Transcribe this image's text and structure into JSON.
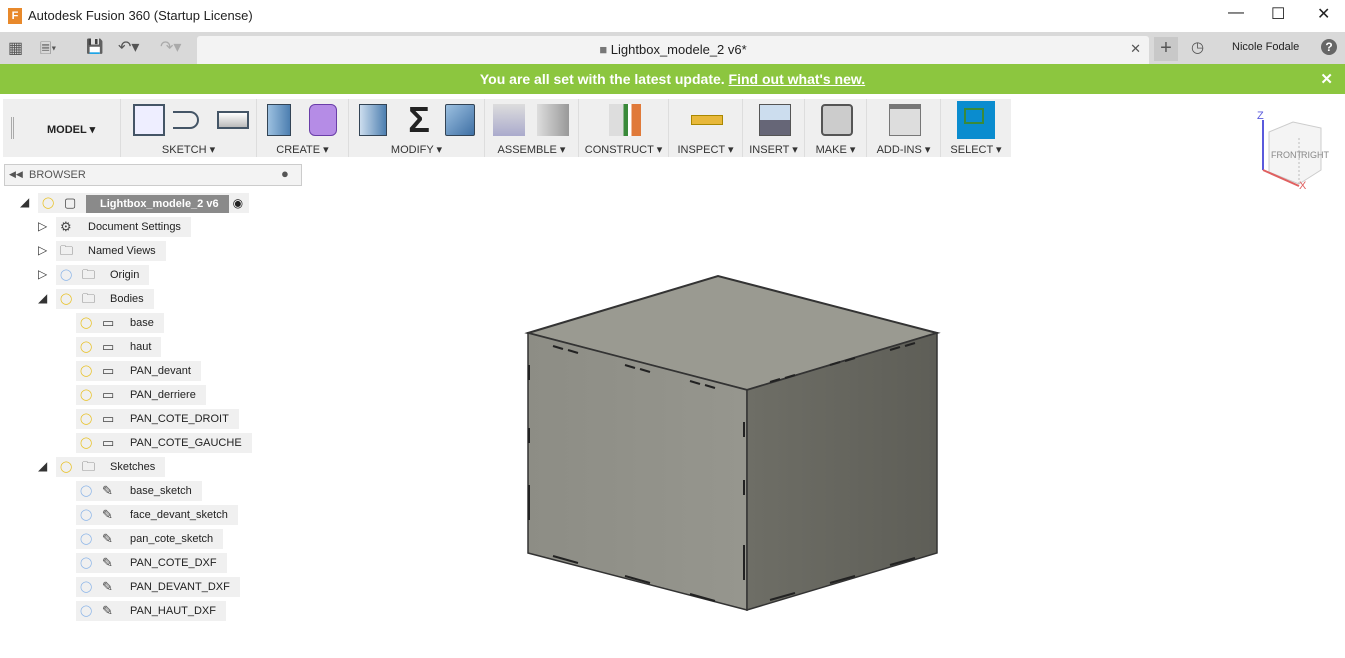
{
  "window": {
    "title": "Autodesk Fusion 360 (Startup License)",
    "app_icon": "F"
  },
  "tab": {
    "name": "Lightbox_modele_2 v6*",
    "user": "Nicole Fodale"
  },
  "banner": {
    "text": "You are all set with the latest update.",
    "link": "Find out what's new.",
    "color": "#8cc63f"
  },
  "toolbar": {
    "workspace": "MODEL ▾",
    "groups": [
      "SKETCH ▾",
      "CREATE ▾",
      "MODIFY ▾",
      "ASSEMBLE ▾",
      "CONSTRUCT ▾",
      "INSPECT ▾",
      "INSERT ▾",
      "MAKE ▾",
      "ADD-INS ▾",
      "SELECT ▾"
    ]
  },
  "browser": {
    "title": "BROWSER",
    "items": [
      {
        "label": "Lightbox_modele_2 v6",
        "level": 0,
        "exp": "open",
        "bulb": "yellow",
        "icon": "component"
      },
      {
        "label": "Document Settings",
        "level": 1,
        "exp": "closed",
        "bulb": "",
        "icon": "gear"
      },
      {
        "label": "Named Views",
        "level": 1,
        "exp": "closed",
        "bulb": "",
        "icon": "folder"
      },
      {
        "label": "Origin",
        "level": 1,
        "exp": "closed",
        "bulb": "blue",
        "icon": "folder"
      },
      {
        "label": "Bodies",
        "level": 1,
        "exp": "open",
        "bulb": "yellow",
        "icon": "folder"
      },
      {
        "label": "base",
        "level": 2,
        "bulb": "yellow",
        "icon": "body"
      },
      {
        "label": "haut",
        "level": 2,
        "bulb": "yellow",
        "icon": "body"
      },
      {
        "label": "PAN_devant",
        "level": 2,
        "bulb": "yellow",
        "icon": "body"
      },
      {
        "label": "PAN_derriere",
        "level": 2,
        "bulb": "yellow",
        "icon": "body"
      },
      {
        "label": "PAN_COTE_DROIT",
        "level": 2,
        "bulb": "yellow",
        "icon": "body"
      },
      {
        "label": "PAN_COTE_GAUCHE",
        "level": 2,
        "bulb": "yellow",
        "icon": "body"
      },
      {
        "label": "Sketches",
        "level": 1,
        "exp": "open",
        "bulb": "yellow",
        "icon": "folder"
      },
      {
        "label": "base_sketch",
        "level": 2,
        "bulb": "blue",
        "icon": "sketch"
      },
      {
        "label": "face_devant_sketch",
        "level": 2,
        "bulb": "blue",
        "icon": "sketch"
      },
      {
        "label": "pan_cote_sketch",
        "level": 2,
        "bulb": "blue",
        "icon": "sketch-warn"
      },
      {
        "label": "PAN_COTE_DXF",
        "level": 2,
        "bulb": "blue",
        "icon": "sketch-warn"
      },
      {
        "label": "PAN_DEVANT_DXF",
        "level": 2,
        "bulb": "blue",
        "icon": "sketch-warn"
      },
      {
        "label": "PAN_HAUT_DXF",
        "level": 2,
        "bulb": "blue",
        "icon": "sketch-warn"
      }
    ]
  },
  "viewcube": {
    "faces": [
      "FRONT",
      "RIGHT"
    ],
    "axes": [
      "Z",
      "X"
    ]
  }
}
